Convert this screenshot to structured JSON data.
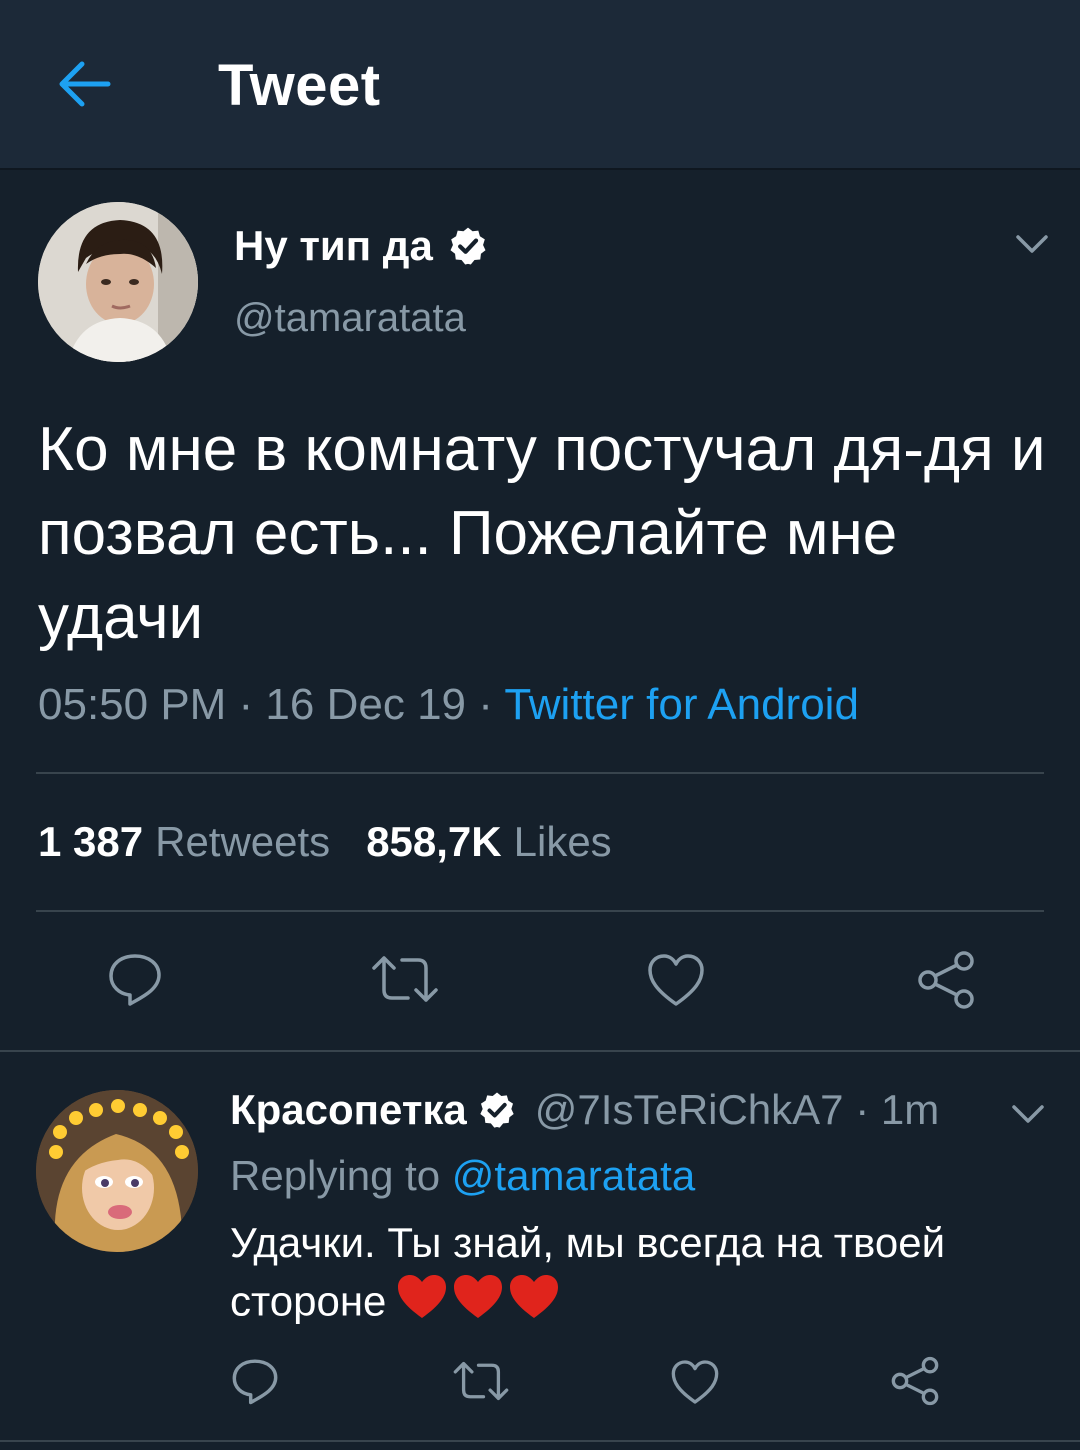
{
  "header": {
    "title": "Tweet",
    "back_icon": "arrow-left-icon"
  },
  "tweet": {
    "display_name": "Ну тип да",
    "handle": "@tamaratata",
    "text": "Ко мне в комнату постучал дя-дя и позвал есть... Пожелайте мне удачи",
    "time": "05:50 PM · 16 Dec 19 · ",
    "source": "Twitter for Android",
    "retweets_count": "1 387",
    "retweets_label": "Retweets",
    "likes_count": "858,7K",
    "likes_label": "Likes"
  },
  "reply": {
    "display_name": "Красопетка",
    "handle": "@7IsTeRiChkA7 · 1m",
    "replying_prefix": "Replying to ",
    "replying_to": "@tamaratata",
    "text": "Удачки. Ты знай, мы всегда на твоей стороне",
    "emoji": "three-red-hearts"
  },
  "colors": {
    "background": "#15202b",
    "header_bg": "#1c2938",
    "accent": "#1da1f2",
    "secondary_text": "#8899a6",
    "divider": "#38444d"
  }
}
